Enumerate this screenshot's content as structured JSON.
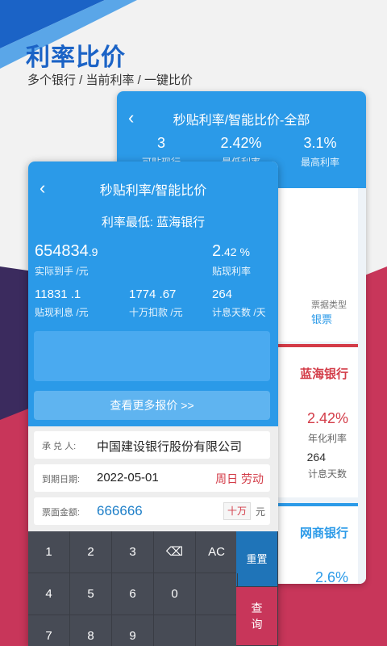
{
  "colors": {
    "primary": "#2b9ae8",
    "promo_title": "#1b63c6",
    "accent_red": "#d33c48",
    "keypad": "#474b55"
  },
  "promo": {
    "title": "利率比价",
    "subtitle": "多个银行 / 当前利率 / 一键比价"
  },
  "back_screen": {
    "title": "秒贴利率/智能比价-全部",
    "stats": [
      {
        "value": "3",
        "label": "可贴现行"
      },
      {
        "value": "2.42%",
        "label": "最低利率"
      },
      {
        "value": "3.1%",
        "label": "最高利率"
      }
    ],
    "ticket_type_label": "票据类型",
    "ticket_type_value": "银票",
    "banks": [
      {
        "name": "蓝海银行",
        "rate": "2.42%",
        "rate_label": "年化利率",
        "days": "264",
        "days_label": "计息天数"
      },
      {
        "name": "网商银行",
        "rate": "2.6%"
      }
    ]
  },
  "front_screen": {
    "title": "秒贴利率/智能比价",
    "lowest": "利率最低: 蓝海银行",
    "actual_amount": {
      "int": "654834",
      "dec": ".9",
      "label": "实际到手 /元"
    },
    "discount_rate": {
      "int": "2",
      "dec": ".42 %",
      "label": "贴现利率"
    },
    "interest": {
      "value": "11831 .1",
      "label": "贴现利息 /元"
    },
    "per_100k": {
      "value": "1774 .67",
      "label": "十万扣款 /元"
    },
    "days": {
      "value": "264",
      "label": "计息天数 /天"
    },
    "more_button": "查看更多报价 >>",
    "form": {
      "acceptor_label": "承 兑 人:",
      "acceptor_value": "中国建设银行股份有限公司",
      "due_label": "到期日期:",
      "due_value": "2022-05-01",
      "due_tag": "周日 劳动",
      "amount_label": "票面金额:",
      "amount_value": "666666",
      "amount_unit_btn": "十万",
      "amount_unit": "元"
    },
    "keypad": {
      "keys": [
        "1",
        "2",
        "3",
        "⌫",
        "AC",
        "4",
        "5",
        "6",
        "0",
        "7",
        "8",
        "9"
      ],
      "reset": "重置",
      "query": "查询"
    }
  }
}
